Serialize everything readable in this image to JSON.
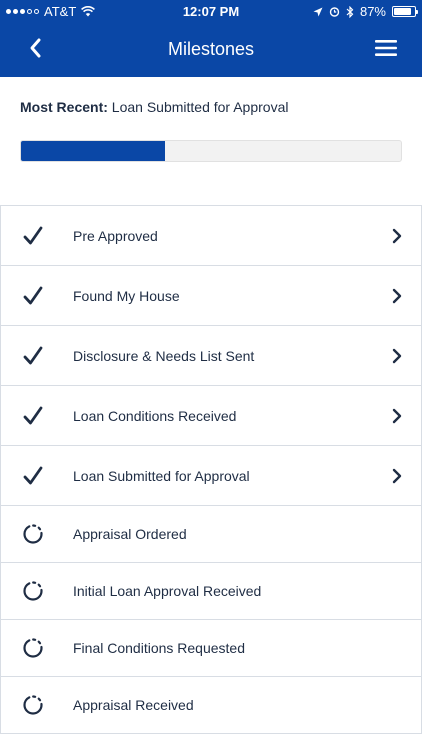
{
  "status_bar": {
    "carrier": "AT&T",
    "time": "12:07 PM",
    "battery": "87%",
    "battery_level": 0.87
  },
  "nav": {
    "title": "Milestones",
    "back_icon": "chevron-left-icon",
    "menu_icon": "hamburger-menu-icon"
  },
  "progress": {
    "most_recent_label": "Most Recent:",
    "most_recent_value": "Loan Submitted for Approval",
    "fraction": 0.38
  },
  "milestones": [
    {
      "label": "Pre Approved",
      "status": "done"
    },
    {
      "label": "Found My House",
      "status": "done"
    },
    {
      "label": "Disclosure & Needs List Sent",
      "status": "done"
    },
    {
      "label": "Loan Conditions Received",
      "status": "done"
    },
    {
      "label": "Loan Submitted for Approval",
      "status": "done"
    },
    {
      "label": "Appraisal Ordered",
      "status": "pending"
    },
    {
      "label": "Initial Loan Approval Received",
      "status": "pending"
    },
    {
      "label": "Final Conditions Requested",
      "status": "pending"
    },
    {
      "label": "Appraisal Received",
      "status": "pending"
    }
  ],
  "colors": {
    "brand_blue": "#0a47a6",
    "text": "#1f2d44",
    "divider": "#d8dde4"
  }
}
